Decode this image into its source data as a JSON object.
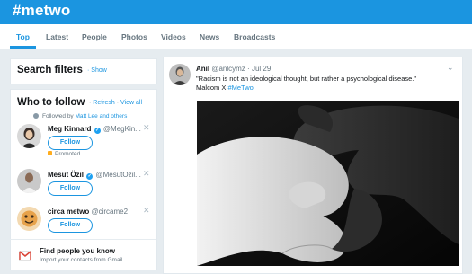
{
  "header": {
    "title": "#metwo"
  },
  "tabs": [
    {
      "label": "Top",
      "active": true
    },
    {
      "label": "Latest"
    },
    {
      "label": "People"
    },
    {
      "label": "Photos"
    },
    {
      "label": "Videos"
    },
    {
      "label": "News"
    },
    {
      "label": "Broadcasts"
    }
  ],
  "search_filters": {
    "title": "Search filters",
    "show": "Show"
  },
  "who_to_follow": {
    "title": "Who to follow",
    "refresh": "Refresh",
    "view_all": "View all",
    "followed_by": "Followed by",
    "followed_by_names": "Matt Lee and others",
    "users": [
      {
        "name": "Meg Kinnard",
        "handle": "@MegKin...",
        "follow": "Follow",
        "promoted": "Promoted"
      },
      {
        "name": "Mesut Özil",
        "handle": "@MesutOzil...",
        "follow": "Follow"
      },
      {
        "name": "circa metwo",
        "handle": "@circame2",
        "follow": "Follow"
      }
    ],
    "find_people": {
      "title": "Find people you know",
      "subtitle": "Import your contacts from Gmail"
    }
  },
  "tweet": {
    "name": "Anıl",
    "handle": "@anlcymz",
    "date": "Jul 29",
    "text_line1": "\"Racism is not an ideological thought, but rather a psychological disease.\"",
    "text_line2": "Malcom X",
    "hashtag": "#MeTwo"
  },
  "colors": {
    "brand": "#1b95e0",
    "header_bg": "#1b95e0",
    "page_bg": "#e6ecf0"
  },
  "icons": [
    "verified-icon",
    "close-icon",
    "chevron-down-icon",
    "gmail-icon",
    "promoted-icon"
  ]
}
